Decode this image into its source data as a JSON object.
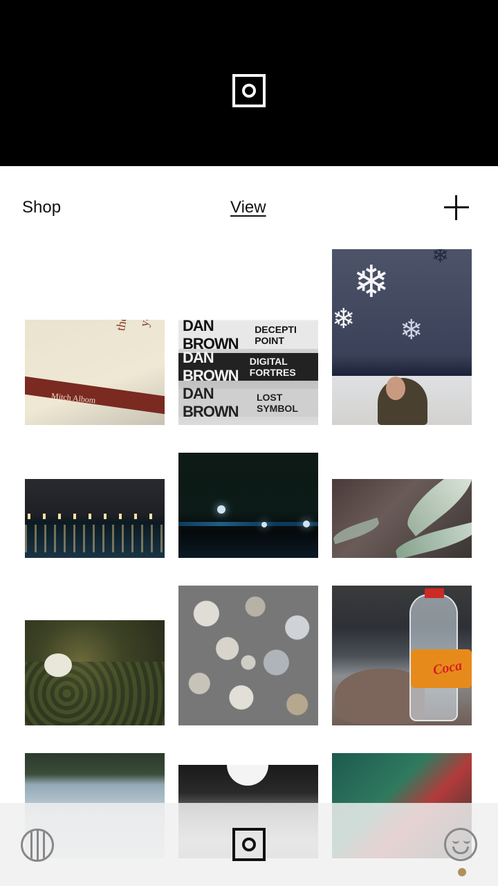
{
  "header": {
    "logo_icon": "vsco-square-logo-icon"
  },
  "nav": {
    "shop_label": "Shop",
    "view_label": "View",
    "add_icon": "plus-icon"
  },
  "grid": {
    "book": {
      "title_line1": "the five people",
      "title_line2": "you meet in hea",
      "author": "Mitch Albom"
    },
    "dan_brown": {
      "row1_author": "DAN BROWN",
      "row1_title": "DECEPTI POINT",
      "row2_author": "DAN BROWN",
      "row2_title": "DIGITAL FORTRES",
      "row3_author": "DAN BROWN",
      "row3_title": "LOST SYMBOL"
    },
    "bottle": {
      "label_text": "Coca"
    }
  },
  "bottom_bar": {
    "grid_icon": "grid-circle-icon",
    "camera_icon": "camera-square-icon",
    "face_icon": "smiley-face-icon",
    "accent_color": "#b0915a"
  }
}
